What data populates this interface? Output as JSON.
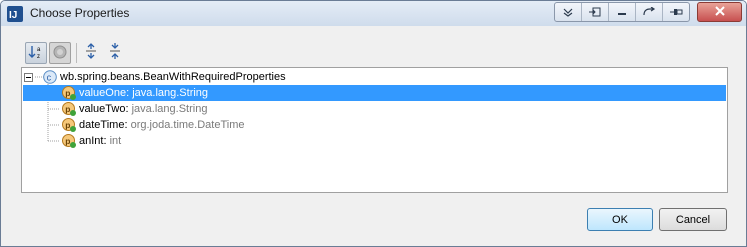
{
  "window": {
    "title": "Choose Properties"
  },
  "tree": {
    "root": {
      "label": "wb.spring.beans.BeanWithRequiredProperties",
      "icon": "class-icon",
      "expanded": true
    },
    "items": [
      {
        "name": "valueOne",
        "separator": ": ",
        "type": "java.lang.String",
        "icon": "property-icon",
        "selected": true
      },
      {
        "name": "valueTwo",
        "separator": ": ",
        "type": "java.lang.String",
        "icon": "property-icon",
        "selected": false
      },
      {
        "name": "dateTime",
        "separator": ": ",
        "type": "org.joda.time.DateTime",
        "icon": "property-icon",
        "selected": false
      },
      {
        "name": "anInt",
        "separator": ": ",
        "type": "int",
        "icon": "property-icon",
        "selected": false
      }
    ]
  },
  "buttons": {
    "ok": "OK",
    "cancel": "Cancel"
  },
  "colors": {
    "selection": "#3399ff",
    "type_text": "#7a7a7a"
  }
}
